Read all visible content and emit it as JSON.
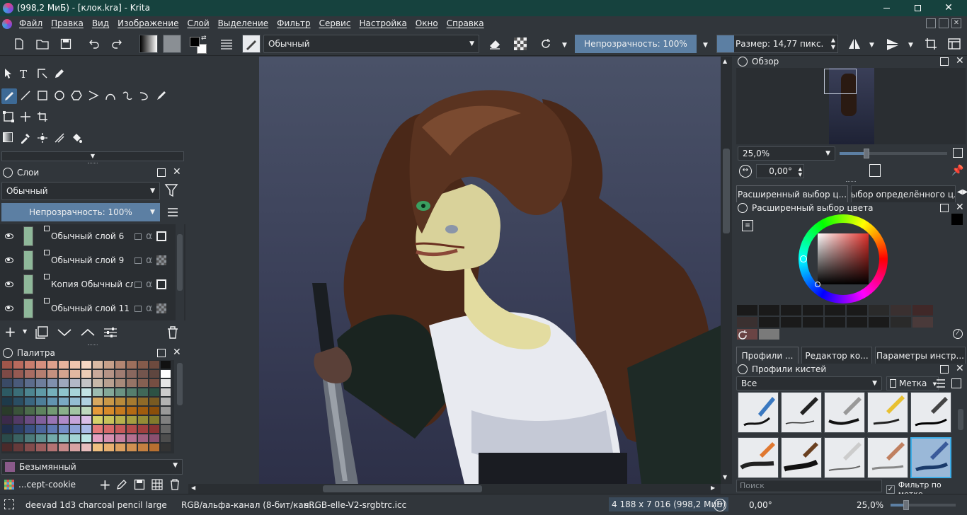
{
  "window": {
    "title": "(998,2 МиБ)  - [клок.kra] - Krita",
    "app_name": "Krita"
  },
  "menu": [
    "Файл",
    "Правка",
    "Вид",
    "Изображение",
    "Слой",
    "Выделение",
    "Фильтр",
    "Сервис",
    "Настройка",
    "Окно",
    "Справка"
  ],
  "toolbar": {
    "blend_mode": "Обычный",
    "opacity_label": "Непрозрачность: 100%",
    "size_label": "Размер: 14,77 пикс."
  },
  "layers": {
    "title": "Слои",
    "blend_mode": "Обычный",
    "opacity_label": "Непрозрачность:  100%",
    "items": [
      {
        "name": "Обычный слой 6"
      },
      {
        "name": "Обычный слой 9"
      },
      {
        "name": "Копия Обычный сл..."
      },
      {
        "name": "Обычный слой 11"
      }
    ]
  },
  "palette": {
    "title": "Палитра",
    "current_name": "Безымянный",
    "resource_name": "...cept-cookie",
    "swatch_colors": [
      "#a0564a",
      "#b96a5d",
      "#c97d6d",
      "#d68f7e",
      "#dfa08c",
      "#e8b39c",
      "#efc4ad",
      "#f3d5c2",
      "#d9b9a3",
      "#c7a08a",
      "#b38672",
      "#9c6f5c",
      "#845b4b",
      "#6d4a3e",
      "#111111",
      "#7d4a46",
      "#965a52",
      "#a86c62",
      "#b47e70",
      "#c5917f",
      "#d4a48f",
      "#e1b8a1",
      "#ebcbb4",
      "#c9a99a",
      "#b69386",
      "#a07c72",
      "#89675e",
      "#73554d",
      "#5e463f",
      "#ffffff",
      "#3a4a66",
      "#4a5a7a",
      "#5c6c8c",
      "#6e7e9c",
      "#8090ad",
      "#9ea8bd",
      "#b2b8c7",
      "#c4c3c4",
      "#c8b8a8",
      "#b9a090",
      "#a88a7a",
      "#977466",
      "#866052",
      "#754e42",
      "#e6e6e6",
      "#2d5a63",
      "#3b6e78",
      "#4d8590",
      "#5f9aa6",
      "#75b0bb",
      "#8ec4cd",
      "#a7d4da",
      "#c2e2e3",
      "#9cbcb0",
      "#83a898",
      "#6b9382",
      "#557e6d",
      "#406858",
      "#2c5244",
      "#cccccc",
      "#1e3a4a",
      "#2a4e63",
      "#3a6680",
      "#4d7e99",
      "#6294b0",
      "#7aa9c3",
      "#94bdd3",
      "#afd0e0",
      "#d6a860",
      "#c99848",
      "#b98a3a",
      "#a67a30",
      "#8f6a28",
      "#785a22",
      "#b3b3b3",
      "#2a3b2a",
      "#3a533a",
      "#4c6b4c",
      "#5e835e",
      "#739a73",
      "#8ab08a",
      "#a3c5a3",
      "#bdd8bd",
      "#e49a3a",
      "#d68a2a",
      "#c67a1e",
      "#b46a14",
      "#a05c0e",
      "#8a4e0a",
      "#999999",
      "#3b2a4a",
      "#523a66",
      "#6a4c82",
      "#815f9c",
      "#9974b4",
      "#b08bc8",
      "#c6a4d9",
      "#dabfe7",
      "#d6d26a",
      "#c8c25a",
      "#b8b04c",
      "#a69e40",
      "#948c36",
      "#827a2c",
      "#808080",
      "#1f2d4a",
      "#2b3e66",
      "#3a5182",
      "#4c659c",
      "#6079b3",
      "#768ec8",
      "#8fa4d9",
      "#aabbe7",
      "#e47a7a",
      "#d66a6a",
      "#c65a5a",
      "#b44c4c",
      "#a04040",
      "#8a3434",
      "#666666",
      "#2a4a4a",
      "#3a6262",
      "#4c7a7a",
      "#5e9292",
      "#73aaaa",
      "#8ac0c0",
      "#a3d4d4",
      "#bde6e6",
      "#e4a0c0",
      "#d690b0",
      "#c680a0",
      "#b47090",
      "#a06080",
      "#8a5070",
      "#4d4d4d",
      "#4a2a2a",
      "#663a3a",
      "#824c4c",
      "#9c5e5e",
      "#b47373",
      "#c88a8a",
      "#d9a3a3",
      "#e7bdbd",
      "#f0c080",
      "#e8b070",
      "#dca060",
      "#d09050",
      "#c48040",
      "#b87030",
      "#333333"
    ]
  },
  "overview": {
    "title": "Обзор",
    "zoom": "25,0%",
    "rotation": "0,00°"
  },
  "color_tabs": [
    "Расширенный выбор ц...",
    "Выбор определённого ц..."
  ],
  "color_panel": {
    "title": "Расширенный выбор цвета",
    "history_colors": [
      "#1a1a1a",
      "#1a1a1a",
      "#1a1a1a",
      "#1a1a1a",
      "#1a1a1a",
      "#1a1a1a",
      "#2a2a2a",
      "#3a3030",
      "#402828",
      "#3a3030",
      "#1a1a1a",
      "#1a1a1a",
      "#1a1a1a",
      "#1a1a1a",
      "#1a1a1a",
      "#1a1a1a",
      "#2a2a2a",
      "#4a3a3a",
      "#6a4444",
      "#7a7a7a"
    ]
  },
  "brush_tabs": [
    "Профили ...",
    "Редактор ко...",
    "Параметры инстр..."
  ],
  "brush_presets": {
    "title": "Профили кистей",
    "filter": "Все",
    "tag_label": "Метка",
    "search_placeholder": "Поиск",
    "filter_by_tag_label": "Фильтр по метке"
  },
  "statusbar": {
    "brush_name": "deevad 1d3 charcoal pencil large",
    "color_model": "RGB/альфа-канал (8-бит/кан...",
    "profile": "sRGB-elle-V2-srgbtrc.icc",
    "image_size": "4 188 x 7 016 (998,2 МиБ)",
    "rotation": "0,00°",
    "zoom": "25,0%"
  }
}
